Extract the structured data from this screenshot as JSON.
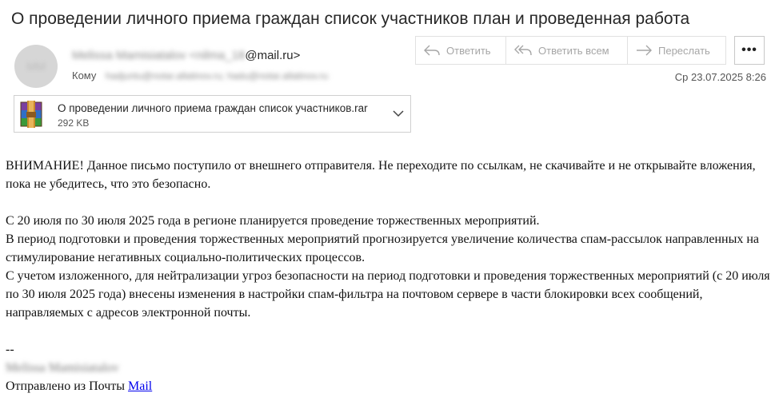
{
  "subject": "О проведении личного приема граждан список участников план и проведенная работа",
  "sender": {
    "avatar_initials": "MM",
    "name_blurred": "Melissa Mamisiatalov",
    "email_blurred": "<nilma_18",
    "email_domain": "@mail.ru>"
  },
  "recipients": {
    "label": "Кому",
    "value_blurred": "hadjuntu@notar.allatinov.ru; hadu@notar.allatinov.ru"
  },
  "actions": {
    "reply_label": "Ответить",
    "reply_all_label": "Ответить всем",
    "forward_label": "Переслать",
    "more_label": "•••"
  },
  "date": "Ср 23.07.2025 8:26",
  "attachment": {
    "name": "О проведении личного приема граждан список участников.rar",
    "size": "292 KB",
    "icon": "winrar-archive-icon"
  },
  "body": {
    "warning": "ВНИМАНИЕ! Данное письмо поступило от внешнего отправителя. Не переходите по ссылкам, не скачивайте и не открывайте вложения, пока не убедитесь, что это безопасно.",
    "paragraph_1": "С 20 июля по 30 июля 2025 года в регионе планируется проведение торжественных мероприятий.",
    "paragraph_2": "В период подготовки и проведения торжественных мероприятий прогнозируется увеличение количества спам-рассылок направленных на стимулирование негативных социально-политических процессов.",
    "paragraph_3": "С учетом изложенного, для нейтрализации угроз безопасности на период подготовки и проведения торжественных мероприятий (с 20 июля по 30 июля 2025 года) внесены изменения в настройки спам-фильтра на почтовом сервере в части блокировки всех сообщений, направляемых с адресов электронной почты.",
    "sig_separator": "--",
    "sig_name_blurred": "Melissa Mamisiatalov",
    "sent_from": "Отправлено из Почты",
    "mail_link": "Mail"
  },
  "colors": {
    "link": "#0000ee",
    "button_text_disabled": "#a6a6a6",
    "border": "#e1e1e1"
  }
}
